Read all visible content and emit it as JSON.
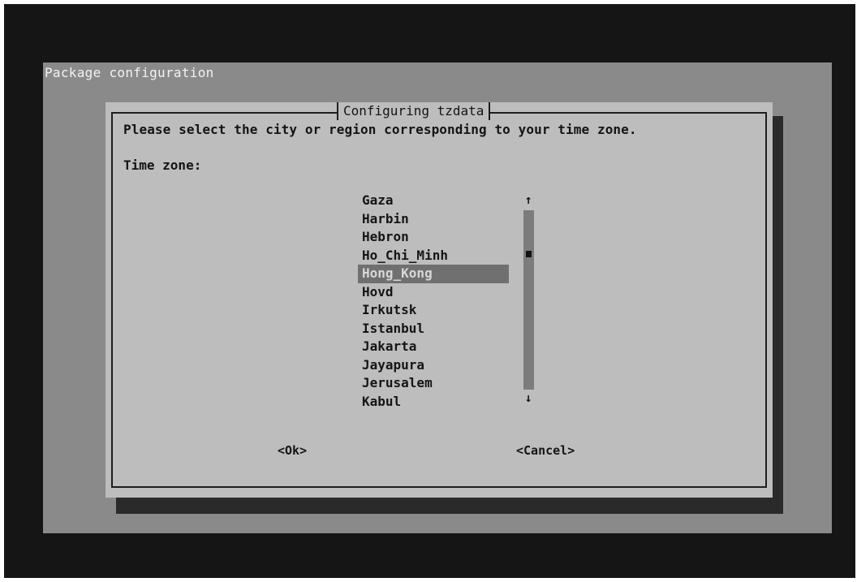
{
  "screen": {
    "title": "Package configuration"
  },
  "dialog": {
    "title": "Configuring tzdata",
    "prompt": "Please select the city or region corresponding to your time zone.",
    "list_label": "Time zone:",
    "items": [
      "Gaza",
      "Harbin",
      "Hebron",
      "Ho_Chi_Minh",
      "Hong_Kong",
      "Hovd",
      "Irkutsk",
      "Istanbul",
      "Jakarta",
      "Jayapura",
      "Jerusalem",
      "Kabul"
    ],
    "selected_index": 4,
    "scroll_up_glyph": "↑",
    "scroll_down_glyph": "↓",
    "ok_label": "<Ok>",
    "cancel_label": "<Cancel>"
  },
  "colors": {
    "screen_bg": "#8a8a8a",
    "dialog_bg": "#bdbdbd",
    "selection_bg": "#707070"
  }
}
